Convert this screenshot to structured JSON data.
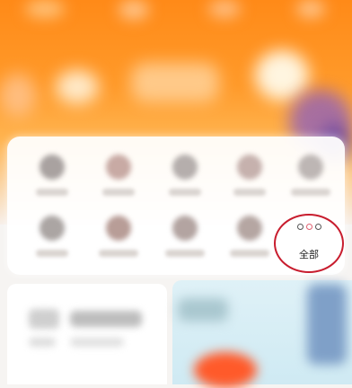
{
  "shortcut_grid": {
    "all_button": {
      "label": "全部",
      "icon": "more-dots-icon"
    }
  },
  "colors": {
    "header_top": "#ff8a18",
    "header_mid": "#ffb450",
    "card": "#ffffff",
    "all_button_border": "#c81d2e",
    "promo_bg": "#dff1f7"
  }
}
